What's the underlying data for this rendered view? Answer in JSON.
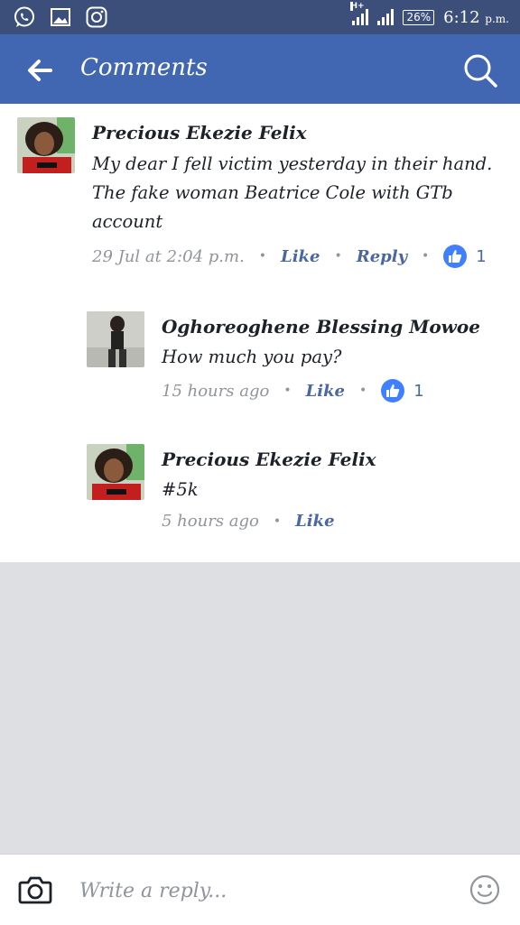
{
  "status_bar": {
    "network_label": "H+",
    "battery": "26%",
    "time": "6:12",
    "time_suffix": "p.m.",
    "icons": [
      "whatsapp-icon",
      "gallery-icon",
      "instagram-icon"
    ]
  },
  "app_bar": {
    "title": "Comments",
    "icons": [
      "back-arrow-icon",
      "search-icon"
    ]
  },
  "comments": [
    {
      "author": "Precious Ekezie Felix",
      "text": "My dear I fell victim yesterday in their hand. The fake woman Beatrice Cole with GTb account",
      "time": "29 Jul at 2:04 p.m.",
      "like_label": "Like",
      "reply_label": "Reply",
      "likes": "1"
    },
    {
      "author": "Oghoreoghene Blessing Mowoe",
      "text": "How much you pay?",
      "time": "15 hours ago",
      "like_label": "Like",
      "likes": "1"
    },
    {
      "author": "Precious Ekezie Felix",
      "text": "#5k",
      "time": "5 hours ago",
      "like_label": "Like"
    }
  ],
  "reply_bar": {
    "placeholder": "Write a reply...",
    "icons": [
      "camera-icon",
      "emoji-icon"
    ]
  },
  "colors": {
    "status_bar": "#3b4f7a",
    "app_bar": "#4267b2",
    "link": "#4b67a1",
    "like_badge": "#4080ff",
    "meta_text": "#90949c",
    "background": "#dddfe2"
  }
}
